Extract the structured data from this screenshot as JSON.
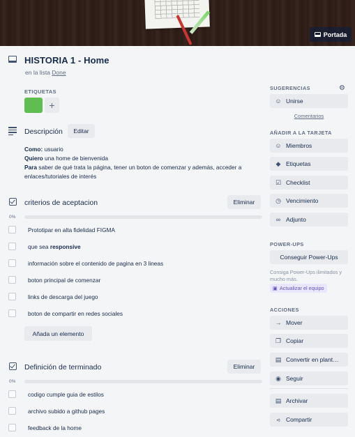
{
  "cover": {
    "button_label": "Portada"
  },
  "card": {
    "title": "HISTORIA 1 - Home",
    "in_list_prefix": "en la lista",
    "list_name": "Done"
  },
  "labels": {
    "heading": "ETIQUETAS",
    "chip_color": "#61bd4f",
    "add_symbol": "+"
  },
  "description": {
    "heading": "Descripción",
    "edit_label": "Editar",
    "como_label": "Como:",
    "como_text": " usuario",
    "quiero_label": "Quiero",
    "quiero_text": " una home de bienvenida",
    "para_label": "Para",
    "para_text": " saber de qué trata la página, tener un boton de comenzar y además, acceder a enlaces/tutoriales de interés"
  },
  "checklists": [
    {
      "title": "criterios de aceptacion",
      "delete_label": "Eliminar",
      "percent": "0%",
      "progress": 0,
      "items": [
        "Prototipar en alta fidelidad FIGMA",
        "que sea ",
        "información sobre el contenido de pagina en 3 lineas",
        "boton principal de comenzar",
        "links de descarga del juego",
        "boton de compartir en redes sociales"
      ],
      "item2_bold": "responsive",
      "add_item_label": "Añada un elemento"
    },
    {
      "title": "Definición de terminado",
      "delete_label": "Eliminar",
      "percent": "0%",
      "progress": 0,
      "items": [
        "codigo cumple guia de estilos",
        "archivo subido a github pages",
        "feedback de la home"
      ]
    }
  ],
  "sidebar": {
    "suggestions_heading": "SUGERENCIAS",
    "join_label": "Unirse",
    "comments_label": "Comentarios",
    "add_heading": "AÑADIR A LA TARJETA",
    "add_items": [
      "Miembros",
      "Etiquetas",
      "Checklist",
      "Vencimiento",
      "Adjunto"
    ],
    "powerups_heading": "POWER-UPS",
    "get_powerups_label": "Conseguir Power-Ups",
    "powerups_desc": "Consiga Power-Ups ilimitados y mucho más.",
    "upgrade_label": "Actualizar el equipo",
    "actions_heading": "ACCIONES",
    "actions": [
      "Mover",
      "Copiar",
      "Convertir en plant…",
      "Seguir",
      "Archivar",
      "Compartir"
    ]
  }
}
